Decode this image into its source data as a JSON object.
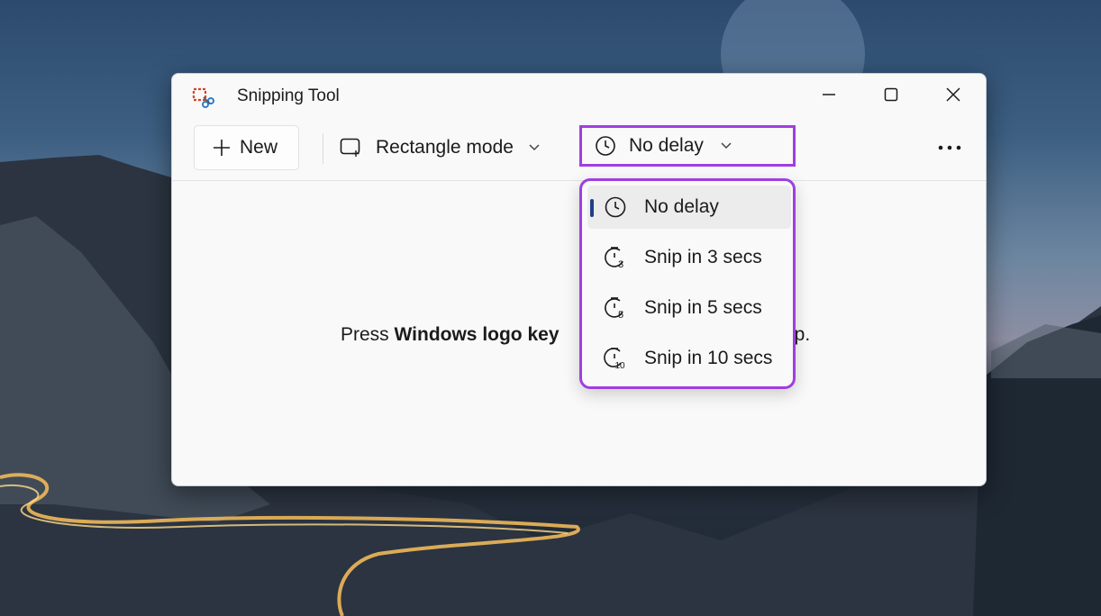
{
  "window": {
    "title": "Snipping Tool",
    "controls": {
      "minimize": "minimize-icon",
      "maximize": "maximize-icon",
      "close": "close-icon"
    }
  },
  "toolbar": {
    "new_label": "New",
    "mode_label": "Rectangle mode",
    "delay_label": "No delay",
    "more_icon": "more-icon"
  },
  "content": {
    "prefix": "Press ",
    "bold": "Windows logo key",
    "tail": "ip."
  },
  "delay_menu": {
    "items": [
      {
        "label": "No delay",
        "icon": "clock-icon",
        "selected": true
      },
      {
        "label": "Snip in 3 secs",
        "icon": "timer-3-icon"
      },
      {
        "label": "Snip in 5 secs",
        "icon": "timer-5-icon"
      },
      {
        "label": "Snip in 10 secs",
        "icon": "timer-10-icon"
      }
    ]
  },
  "colors": {
    "highlight": "#a03ee0",
    "indicator": "#1f3e8a"
  }
}
